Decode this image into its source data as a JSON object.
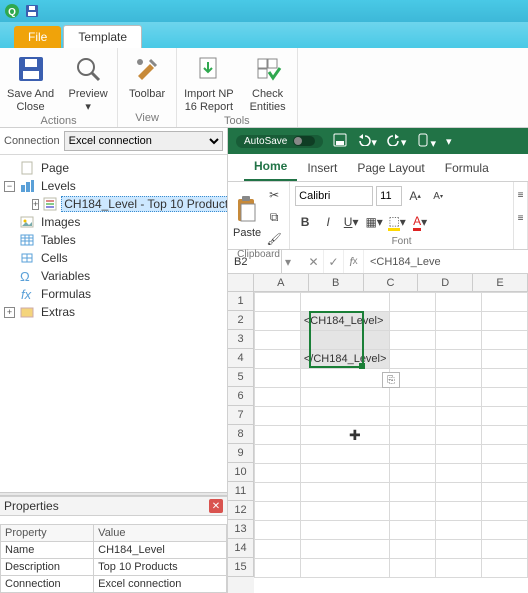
{
  "titlebar": {
    "app_icon": "Q",
    "save_icon": "💾"
  },
  "tabs": {
    "file": "File",
    "template": "Template"
  },
  "ribbon": {
    "save_close": "Save And\nClose",
    "preview": "Preview",
    "toolbar": "Toolbar",
    "import": "Import NP\n16 Report",
    "check": "Check\nEntities",
    "grp_actions": "Actions",
    "grp_view": "View",
    "grp_tools": "Tools"
  },
  "connection": {
    "label": "Connection",
    "selected": "Excel connection"
  },
  "tree": {
    "page": "Page",
    "levels": "Levels",
    "level_item": "CH184_Level - Top 10 Products",
    "images": "Images",
    "tables": "Tables",
    "cells": "Cells",
    "variables": "Variables",
    "formulas": "Formulas",
    "extras": "Extras"
  },
  "properties": {
    "title": "Properties",
    "col_prop": "Property",
    "col_val": "Value",
    "rows": {
      "name_k": "Name",
      "name_v": "CH184_Level",
      "desc_k": "Description",
      "desc_v": "Top 10 Products",
      "conn_k": "Connection",
      "conn_v": "Excel connection"
    }
  },
  "excel": {
    "autosave": "AutoSave",
    "tabs": {
      "home": "Home",
      "insert": "Insert",
      "pagelayout": "Page Layout",
      "formulas": "Formula"
    },
    "paste": "Paste",
    "font_name": "Calibri",
    "font_size": "11",
    "grp_clipboard": "Clipboard",
    "grp_font": "Font",
    "namebox": "B2",
    "formula": "<CH184_Leve",
    "cols": [
      "A",
      "B",
      "C",
      "D",
      "E"
    ],
    "rows": [
      "1",
      "2",
      "3",
      "4",
      "5",
      "6",
      "7",
      "8",
      "9",
      "10",
      "11",
      "12",
      "13",
      "14",
      "15"
    ]
  },
  "chart_data": {
    "type": "table",
    "active_cell": "B2",
    "selection": "B2:B4",
    "cells": {
      "B2": "<CH184_Level>",
      "B4": "</CH184_Level>"
    }
  }
}
